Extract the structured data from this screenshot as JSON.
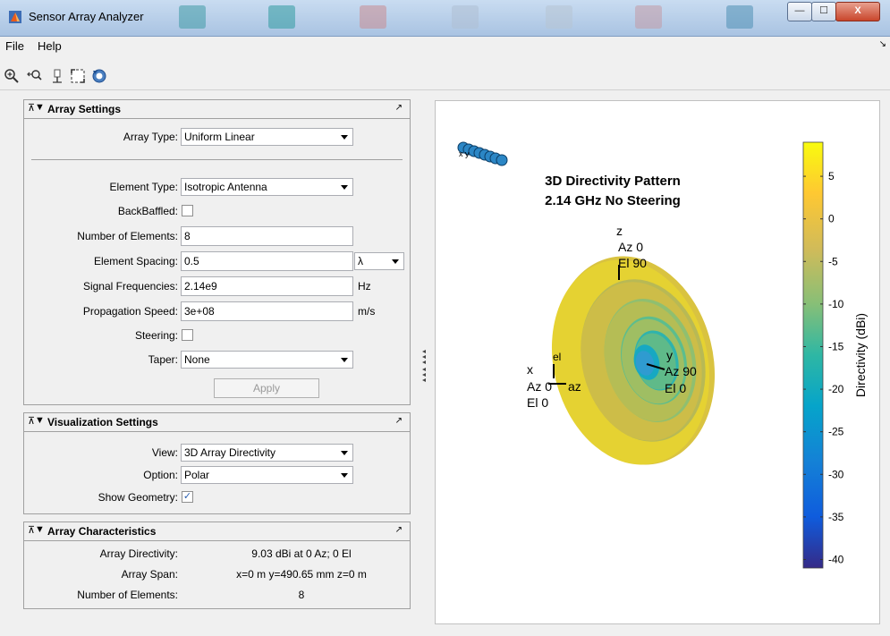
{
  "window": {
    "title": "Sensor Array Analyzer",
    "minimize_glyph": "—",
    "maximize_glyph": "☐",
    "close_glyph": "X"
  },
  "menu": [
    "File",
    "Help"
  ],
  "toolbar_icons": [
    "zoom-in-icon",
    "pan-icon",
    "rotate-icon",
    "fit-icon",
    "reset-view-icon"
  ],
  "array_settings": {
    "title": "Array Settings",
    "array_type_label": "Array Type:",
    "array_type_value": "Uniform Linear",
    "element_type_label": "Element Type:",
    "element_type_value": "Isotropic Antenna",
    "backbaffled_label": "BackBaffled:",
    "num_elements_label": "Number of Elements:",
    "num_elements_value": "8",
    "element_spacing_label": "Element Spacing:",
    "element_spacing_value": "0.5",
    "spacing_unit_value": "λ",
    "signal_freq_label": "Signal Frequencies:",
    "signal_freq_value": "2.14e9",
    "signal_freq_unit": "Hz",
    "prop_speed_label": "Propagation Speed:",
    "prop_speed_value": "3e+08",
    "prop_speed_unit": "m/s",
    "steering_label": "Steering:",
    "taper_label": "Taper:",
    "taper_value": "None",
    "apply_label": "Apply"
  },
  "visualization_settings": {
    "title": "Visualization Settings",
    "view_label": "View:",
    "view_value": "3D Array Directivity",
    "option_label": "Option:",
    "option_value": "Polar",
    "show_geometry_label": "Show Geometry:",
    "show_geometry_check": "✓"
  },
  "array_characteristics": {
    "title": "Array Characteristics",
    "rows": [
      {
        "label": "Array Directivity:",
        "value": "9.03 dBi at 0 Az; 0 El"
      },
      {
        "label": "Array Span:",
        "value": "x=0 m y=490.65 mm z=0 m"
      },
      {
        "label": "Number of Elements:",
        "value": "8"
      }
    ]
  },
  "plot": {
    "title_line1": "3D Directivity Pattern",
    "title_line2": "2.14 GHz No Steering",
    "z_label": [
      "z",
      "Az 0",
      "El 90"
    ],
    "x_label": [
      "x",
      "Az 0",
      "El 0"
    ],
    "y_label": [
      "y",
      "Az 90",
      "El 0"
    ],
    "el_label": "el",
    "az_label": "az",
    "geometry_labels": "x y",
    "colorbar_label": "Directivity (dBi)",
    "colorbar_ticks": [
      "5",
      "0",
      "-5",
      "-10",
      "-15",
      "-20",
      "-25",
      "-30",
      "-35",
      "-40"
    ],
    "colorbar_tick_values": [
      5,
      0,
      -5,
      -10,
      -15,
      -20,
      -25,
      -30,
      -35,
      -40
    ],
    "colorbar_range": [
      -41,
      9
    ],
    "colormap": [
      "#352a87",
      "#0f5cdd",
      "#1481d6",
      "#06a4ca",
      "#2eb7a4",
      "#87bf77",
      "#d1bb59",
      "#fec832",
      "#f9fb0e"
    ]
  },
  "glyphs": {
    "pin": "⊼",
    "collapse": "▼",
    "expand": "↗"
  }
}
